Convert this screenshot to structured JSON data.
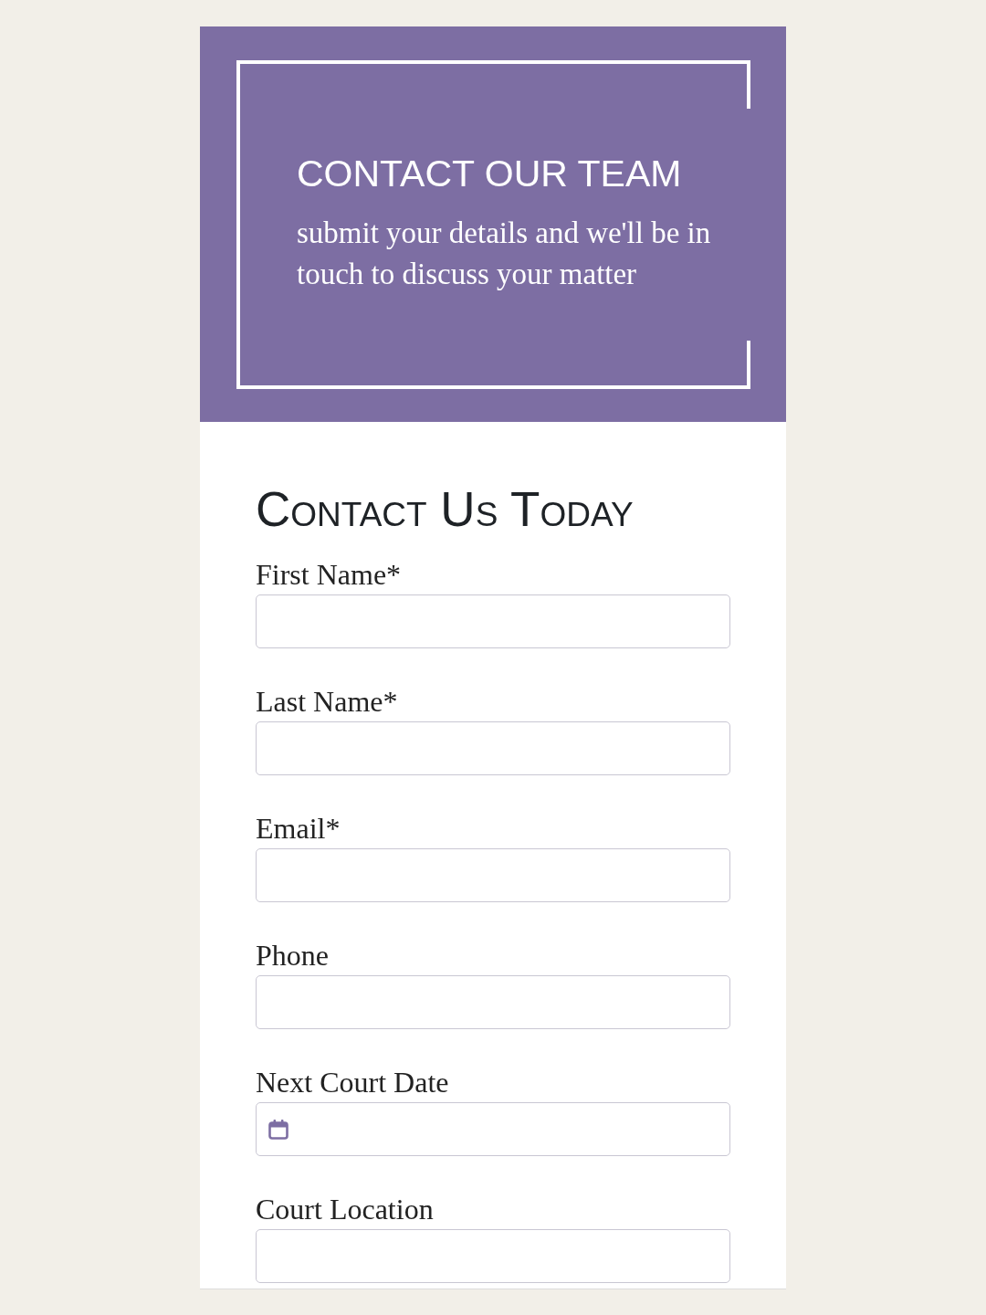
{
  "header": {
    "title": "CONTACT OUR TEAM",
    "subtitle": "submit your details and we'll be in touch to discuss your matter"
  },
  "form": {
    "heading": "Contact Us Today",
    "fields": [
      {
        "label": "First Name*",
        "kind": "text"
      },
      {
        "label": "Last Name*",
        "kind": "text"
      },
      {
        "label": "Email*",
        "kind": "text"
      },
      {
        "label": "Phone",
        "kind": "text"
      },
      {
        "label": "Next Court Date",
        "kind": "date"
      },
      {
        "label": "Court Location",
        "kind": "text"
      }
    ]
  }
}
